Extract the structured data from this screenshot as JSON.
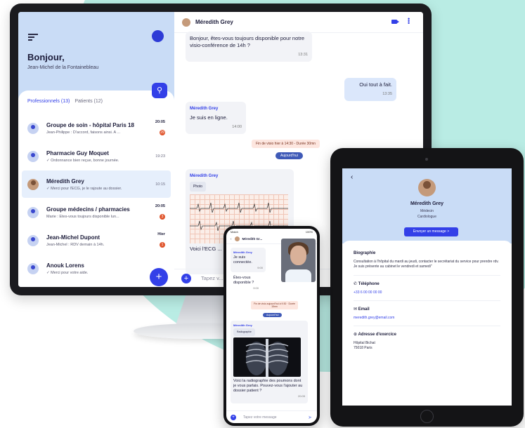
{
  "desktop": {
    "sidebar": {
      "greeting": "Bonjour,",
      "user_name": "Jean-Michel de la Fontainebleau",
      "tabs": [
        {
          "label": "Professionnels (13)"
        },
        {
          "label": "Patients (12)"
        }
      ],
      "conversations": [
        {
          "name": "Groupe de soin - hôpital Paris 18",
          "last_message": "Jean-Philippe : D'accord, faisons ainsi. A ...",
          "time": "20:05",
          "unread": "29"
        },
        {
          "name": "Pharmacie Guy Moquet",
          "last_message": "✓ Ordonnance bien reçue, bonne journée.",
          "time": "19:23",
          "unread": ""
        },
        {
          "name": "Méredith Grey",
          "last_message": "✓ Merci pour l'ECG, je le rajoute au dossier.",
          "time": "10:15",
          "unread": ""
        },
        {
          "name": "Groupe médecins / pharmacies",
          "last_message": "Marie : Êtes-vous toujours disponible lun...",
          "time": "20:05",
          "unread": "3"
        },
        {
          "name": "Jean-Michel Dupont",
          "last_message": "Jean-Michel : RDV demain à 14h.",
          "time": "Hier",
          "unread": "1"
        },
        {
          "name": "Anouk Lorens",
          "last_message": "✓ Merci pour votre aide.",
          "time": "",
          "unread": ""
        }
      ],
      "fab_label": "+"
    },
    "chat": {
      "contact_name": "Méredith Grey",
      "messages": [
        {
          "text": "Bonjour, êtes-vous toujours disponible pour notre visio-conférence de 14h ?",
          "time": "13:31"
        },
        {
          "text": "Oui tout à fait.",
          "time": "13:35"
        },
        {
          "sender": "Méredith Grey",
          "text": "Je suis en ligne.",
          "time": "14:00"
        },
        {
          "sender": "Méredith Grey",
          "photo_label": "Photo",
          "text": "Voici l'ECG ... pensez-vou..."
        }
      ],
      "system_end": "Fin de visio hier à 14:30 - Durée 30mn",
      "system_today": "Aujourd'hui",
      "input_placeholder": "Tapez v..."
    }
  },
  "tablet": {
    "name": "Méredith Grey",
    "role": "Médecin",
    "specialty": "Cardiologue",
    "action_button": "Envoyer un message  >",
    "sections": [
      {
        "title": "Biographie",
        "lines": [
          "Consultation à l'hôpital du mardi au jeudi, contacter le secrétariat du service pour prendre rdv.",
          "Je suis présente au cabinet le vendredi et samedi\""
        ]
      },
      {
        "title": "✆ Téléphone",
        "lines": [
          "+33 6 00 00 00 00"
        ],
        "link": true
      },
      {
        "title": "✉ Email",
        "lines": [
          "meredith.grey@email.com"
        ],
        "link": true
      },
      {
        "title": "⊙ Adresse d'exercice",
        "lines": [
          "Hôpital Bichat",
          "75018 Paris"
        ]
      }
    ]
  },
  "phone": {
    "status_time": "Match",
    "status_battery": "100%",
    "contact": "Méredith Gr...",
    "messages": [
      {
        "sender": "Méredith Grey",
        "text": "Je suis connectée.",
        "time": "9:00"
      },
      {
        "text": "Êtes-vous disponible ?",
        "time": "9:00"
      },
      {
        "sender": "Méredith Grey",
        "photo_label": "Radiographie",
        "text": "Voici la radiographie des poumons dont je vous parlais. Pouvez-vous l'ajouter au dossier patient ?",
        "time": "20:05"
      }
    ],
    "system_end": "Fin de visio aujourd'hui à 9:30 · Durée 15mn",
    "system_today": "Aujourd'hui",
    "input_placeholder": "Tapez votre message"
  },
  "colors": {
    "accent": "#3340e8",
    "panel": "#c9dcf6",
    "badge": "#e0562e",
    "background_circle": "#b9ece4"
  }
}
